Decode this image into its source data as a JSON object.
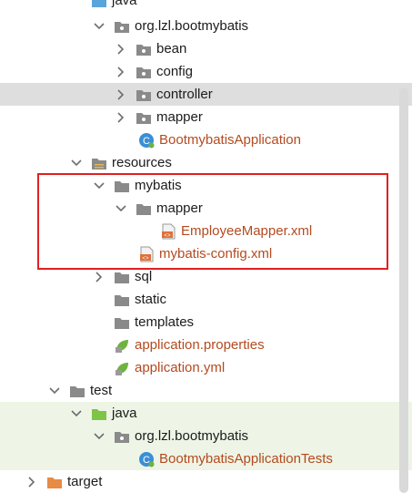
{
  "tree": {
    "rows": [
      {
        "label": "java",
        "icon": "folder-blue-icon"
      },
      {
        "label": "org.lzl.bootmybatis",
        "icon": "package-icon"
      },
      {
        "label": "bean",
        "icon": "package-icon"
      },
      {
        "label": "config",
        "icon": "package-icon"
      },
      {
        "label": "controller",
        "icon": "package-icon"
      },
      {
        "label": "mapper",
        "icon": "package-icon"
      },
      {
        "label": "BootmybatisApplication",
        "icon": "spring-class-icon"
      },
      {
        "label": "resources",
        "icon": "resources-folder-icon"
      },
      {
        "label": "mybatis",
        "icon": "folder-icon"
      },
      {
        "label": "mapper",
        "icon": "folder-icon"
      },
      {
        "label": "EmployeeMapper.xml",
        "icon": "xml-file-icon"
      },
      {
        "label": "mybatis-config.xml",
        "icon": "xml-file-icon"
      },
      {
        "label": "sql",
        "icon": "folder-icon"
      },
      {
        "label": "static",
        "icon": "folder-icon"
      },
      {
        "label": "templates",
        "icon": "folder-icon"
      },
      {
        "label": "application.properties",
        "icon": "spring-properties-icon"
      },
      {
        "label": "application.yml",
        "icon": "spring-properties-icon"
      },
      {
        "label": "test",
        "icon": "folder-icon"
      },
      {
        "label": "java",
        "icon": "folder-green-icon"
      },
      {
        "label": "org.lzl.bootmybatis",
        "icon": "package-icon"
      },
      {
        "label": "BootmybatisApplicationTests",
        "icon": "spring-class-icon"
      },
      {
        "label": "target",
        "icon": "folder-orange-icon"
      }
    ]
  },
  "colors": {
    "selected_row": "#dedede",
    "test_background": "#eef5e6",
    "highlight_border": "#e02020",
    "class_text": "#b44a1f",
    "folder_gray": "#8a8a8a",
    "folder_blue": "#5aa4dc",
    "folder_green": "#7ec447",
    "folder_orange": "#e88b45"
  }
}
